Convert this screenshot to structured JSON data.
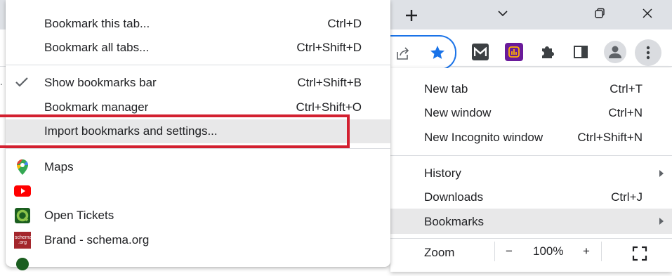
{
  "submenu": {
    "items": [
      {
        "label": "Bookmark this tab...",
        "shortcut": "Ctrl+D"
      },
      {
        "label": "Bookmark all tabs...",
        "shortcut": "Ctrl+Shift+D"
      },
      {
        "label": "Show bookmarks bar",
        "shortcut": "Ctrl+Shift+B"
      },
      {
        "label": "Bookmark manager",
        "shortcut": "Ctrl+Shift+O"
      },
      {
        "label": "Import bookmarks and settings..."
      }
    ],
    "bookmarks": [
      {
        "label": "Maps",
        "icon": "google-maps-icon"
      },
      {
        "label": "",
        "icon": "youtube-icon"
      },
      {
        "label": "Open Tickets",
        "icon": "open-tickets-icon"
      },
      {
        "label": "Brand - schema.org",
        "icon": "schema-org-icon",
        "favicon_text": "schema .org"
      }
    ]
  },
  "mainmenu": {
    "items": [
      {
        "label": "New tab",
        "shortcut": "Ctrl+T"
      },
      {
        "label": "New window",
        "shortcut": "Ctrl+N"
      },
      {
        "label": "New Incognito window",
        "shortcut": "Ctrl+Shift+N"
      },
      {
        "label": "History"
      },
      {
        "label": "Downloads",
        "shortcut": "Ctrl+J"
      },
      {
        "label": "Bookmarks"
      }
    ],
    "zoom": {
      "label": "Zoom",
      "minus": "−",
      "value": "100%",
      "plus": "+"
    }
  },
  "colors": {
    "accent": "#1a73e8",
    "highlight": "#e8e8e9",
    "annotation_red": "#d32030"
  }
}
